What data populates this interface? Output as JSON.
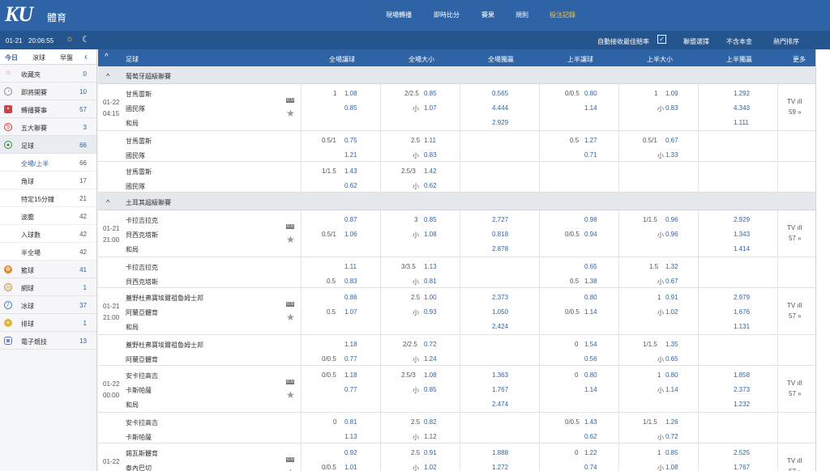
{
  "brand": {
    "logo": "KU",
    "sub": "體育"
  },
  "nav": [
    "現場轉播",
    "即時比分",
    "賽果",
    "規則",
    "投注記錄"
  ],
  "subbar": {
    "date": "01-21",
    "time": "20:06:55",
    "auto": "自動接收最佳賠率",
    "league_filter": "聯盟選擇",
    "currency": "不含本金",
    "sort": "熱門排序"
  },
  "sidebar": {
    "tabs": [
      "今日",
      "滾球",
      "早盤"
    ],
    "items": [
      {
        "label": "收藏夾",
        "count": "0",
        "icon": "star-icon"
      },
      {
        "label": "即將開賽",
        "count": "10",
        "icon": "clock-icon"
      },
      {
        "label": "轉播賽事",
        "count": "57",
        "icon": "tv-icon"
      },
      {
        "label": "五大聯賽",
        "count": "3",
        "icon": "five-icon"
      },
      {
        "label": "足球",
        "count": "66",
        "icon": "soccer-icon"
      }
    ],
    "subs": [
      {
        "label": "全場/上半",
        "count": "66"
      },
      {
        "label": "角球",
        "count": "17"
      },
      {
        "label": "特定15分鐘",
        "count": "21"
      },
      {
        "label": "波膽",
        "count": "42"
      },
      {
        "label": "入球數",
        "count": "42"
      },
      {
        "label": "半全場",
        "count": "42"
      }
    ],
    "others": [
      {
        "label": "籃球",
        "count": "41",
        "icon": "basketball-icon"
      },
      {
        "label": "網球",
        "count": "1",
        "icon": "tennis-icon"
      },
      {
        "label": "冰球",
        "count": "37",
        "icon": "hockey-icon"
      },
      {
        "label": "排球",
        "count": "1",
        "icon": "volleyball-icon"
      },
      {
        "label": "電子競技",
        "count": "13",
        "icon": "esports-icon"
      }
    ]
  },
  "columns": [
    "足球",
    "全場讓球",
    "全場大小",
    "全場獨贏",
    "上半讓球",
    "上半大小",
    "上半獨贏",
    "更多"
  ],
  "leagues": [
    "葡萄牙超級聯賽",
    "土耳其超級聯賽"
  ]
}
